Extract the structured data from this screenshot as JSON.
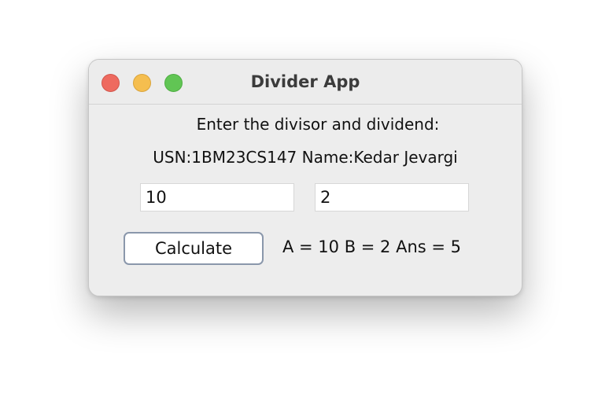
{
  "window": {
    "title": "Divider App"
  },
  "labels": {
    "prompt": "Enter the divisor and dividend:",
    "usn_name": "USN:1BM23CS147 Name:Kedar Jevargi"
  },
  "inputs": {
    "first_value": "10",
    "second_value": "2"
  },
  "actions": {
    "calculate_label": "Calculate"
  },
  "result": {
    "text": "A = 10 B = 2 Ans = 5"
  },
  "colors": {
    "close": "#ee6a5f",
    "minimize": "#f5be4f",
    "maximize": "#61c554",
    "button_border": "#8a97ab",
    "window_bg": "#ededed"
  }
}
